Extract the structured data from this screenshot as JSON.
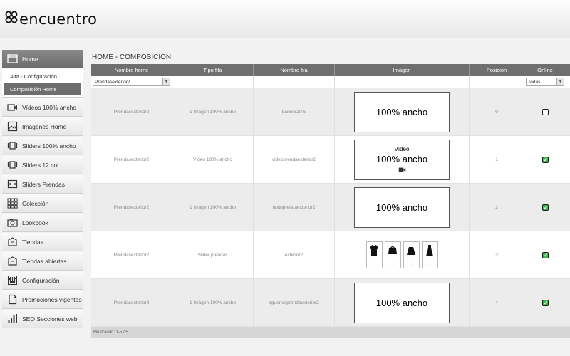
{
  "brand": {
    "name": "encuentro"
  },
  "sidebar": {
    "home": {
      "label": "Home",
      "icon": "window-icon"
    },
    "sub_items": [
      {
        "label": "Alta - Configuración",
        "active": false
      },
      {
        "label": "Composición Home",
        "active": true
      }
    ],
    "items": [
      {
        "label": "Vídeos 100% ancho",
        "icon": "video-camera-icon"
      },
      {
        "label": "Imágenes Home",
        "icon": "image-icon"
      },
      {
        "label": "Sliders 100% ancho",
        "icon": "slider-icon"
      },
      {
        "label": "Sliders 12 coL",
        "icon": "slider-icon"
      },
      {
        "label": "Sliders Prendas",
        "icon": "slider-arrows-icon"
      },
      {
        "label": "Colección",
        "icon": "grid-icon"
      },
      {
        "label": "Lookbook",
        "icon": "camera-icon"
      },
      {
        "label": "Tiendas",
        "icon": "store-icon"
      },
      {
        "label": "Tiendas abiertas",
        "icon": "store-icon"
      },
      {
        "label": "Configuración",
        "icon": "sliders-settings-icon"
      },
      {
        "label": "Promociones vigentes",
        "icon": "document-icon"
      },
      {
        "label": "SEO Secciones web",
        "icon": "bar-chart-icon"
      }
    ]
  },
  "main": {
    "title": "HOME - COMPOSICIÓN",
    "columns": [
      "Nombre home",
      "Tipo fila",
      "Nombre fila",
      "Imágen",
      "Posición",
      "Online"
    ],
    "filters": {
      "nombre_home": "Prendasexterior2",
      "online": "Todas"
    },
    "rows": [
      {
        "home": "Prendasexterior2",
        "tipo": "1 Imágen 100% ancho",
        "nombre": "banner20%",
        "preview": {
          "kind": "text",
          "top": "",
          "main": "100% ancho",
          "icon": ""
        },
        "pos": "0",
        "online": false
      },
      {
        "home": "Prendasexterior2",
        "tipo": "Vídeo 100% ancho",
        "nombre": "videoprendaexterior2",
        "preview": {
          "kind": "text",
          "top": "Vídeo",
          "main": "100% ancho",
          "icon": "video-camera-icon"
        },
        "pos": "1",
        "online": true
      },
      {
        "home": "Prendasexterior2",
        "tipo": "1 Imágen 100% ancho",
        "nombre": "textoprendaexterior2",
        "preview": {
          "kind": "text",
          "top": "",
          "main": "100% ancho",
          "icon": ""
        },
        "pos": "2",
        "online": true
      },
      {
        "home": "Prendasexterior2",
        "tipo": "Slider prendas",
        "nombre": "exterior2",
        "preview": {
          "kind": "slider",
          "top": "",
          "main": "",
          "icon": ""
        },
        "pos": "3",
        "online": true
      },
      {
        "home": "Prendasexterior2",
        "tipo": "1 Imágen 100% ancho",
        "nombre": "aguenosprendaexterior2",
        "preview": {
          "kind": "text",
          "top": "",
          "main": "100% ancho",
          "icon": ""
        },
        "pos": "4",
        "online": true
      }
    ],
    "footer": "Mostrando: 1-5 / 5"
  }
}
